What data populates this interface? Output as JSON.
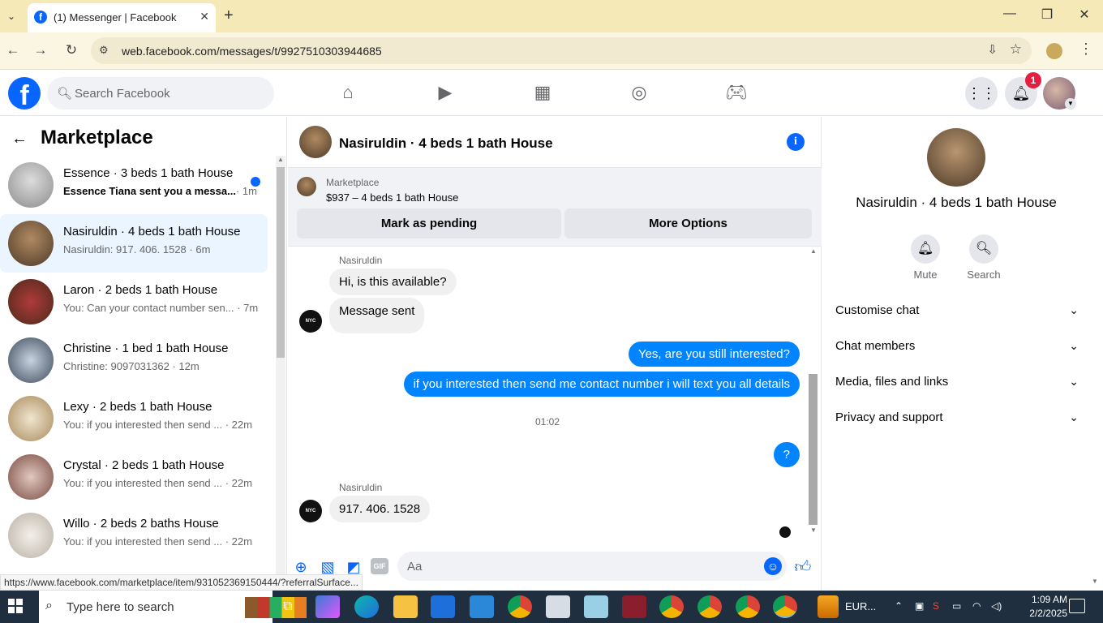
{
  "browser": {
    "tab_title": "(1) Messenger | Facebook",
    "url": "web.facebook.com/messages/t/9927510303944685",
    "status_url": "https://www.facebook.com/marketplace/item/931052369150444/?referralSurface..."
  },
  "fb": {
    "search_placeholder": "Search Facebook",
    "notification_count": "1",
    "brand_color": "#0866ff"
  },
  "marketplace": {
    "title": "Marketplace",
    "conversations": [
      {
        "name": "Essence · 3 beds 1 bath House",
        "snippet": "Essence Tiana sent you a messa...",
        "time": "· 1m",
        "unread": true
      },
      {
        "name": "Nasiruldin · 4 beds 1 bath House",
        "snippet": "Nasiruldin: 917. 406. 1528",
        "time": " · 6m",
        "active": true
      },
      {
        "name": "Laron · 2 beds 1 bath House",
        "snippet": "You: Can your contact number sen...",
        "time": " · 7m"
      },
      {
        "name": "Christine · 1 bed 1 bath House",
        "snippet": "Christine: 9097031362",
        "time": " · 12m"
      },
      {
        "name": "Lexy · 2 beds 1 bath House",
        "snippet": "You: if you interested then send ...",
        "time": " · 22m"
      },
      {
        "name": "Crystal · 2 beds 1 bath House",
        "snippet": "You: if you interested then send ...",
        "time": " · 22m"
      },
      {
        "name": "Willo · 2 beds 2 baths House",
        "snippet": "You: if you interested then send ...",
        "time": " · 22m"
      }
    ]
  },
  "chat": {
    "title": "Nasiruldin · 4 beds 1 bath House",
    "listing_label": "Marketplace",
    "listing_price": "$937 – 4 beds 1 bath House",
    "mark_pending": "Mark as pending",
    "more_options": "More Options",
    "messages": {
      "sender1": "Nasiruldin",
      "in1": "Hi, is this available?",
      "in2": "Message sent",
      "out1": "Yes, are you still interested?",
      "out2": "if you interested then send me contact number i will text you all details",
      "timestamp": "01:02",
      "out3": "?",
      "sender2": "Nasiruldin",
      "in3": "917. 406. 1528"
    },
    "composer_placeholder": "Aa"
  },
  "details": {
    "name": "Nasiruldin · 4 beds 1 bath House",
    "mute": "Mute",
    "search": "Search",
    "sections": [
      "Customise chat",
      "Chat members",
      "Media, files and links",
      "Privacy and support"
    ]
  },
  "taskbar": {
    "search_placeholder": "Type here to search",
    "currency": "EUR...",
    "time": "1:09 AM",
    "date": "2/2/2025"
  }
}
